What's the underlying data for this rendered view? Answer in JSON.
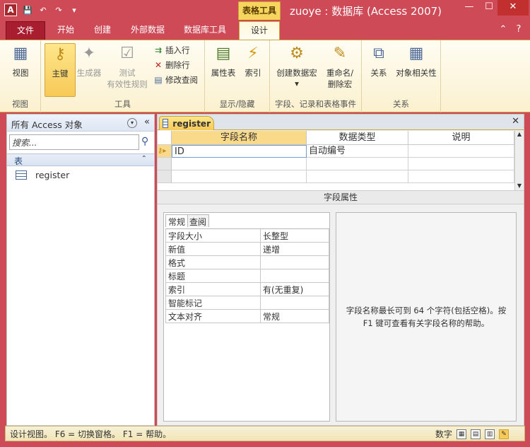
{
  "window": {
    "title": "zuoye : 数据库 (Access 2007)",
    "context_tab": "表格工具"
  },
  "qat": {
    "app_icon": "A"
  },
  "tabs": [
    {
      "label": "文件"
    },
    {
      "label": "开始"
    },
    {
      "label": "创建"
    },
    {
      "label": "外部数据"
    },
    {
      "label": "数据库工具"
    },
    {
      "label": "设计"
    }
  ],
  "ribbon": {
    "view": {
      "title": "视图",
      "btn": "视图"
    },
    "tools": {
      "title": "工具",
      "primary_key": "主键",
      "builder": "生成器",
      "test_line1": "测试",
      "test_line2": "有效性规则",
      "insert_row": "插入行",
      "delete_row": "删除行",
      "modify_lookup": "修改查阅"
    },
    "showhide": {
      "title": "显示/隐藏",
      "property_sheet": "属性表",
      "indexes": "索引"
    },
    "events": {
      "title": "字段、记录和表格事件",
      "create_macro": "创建数据宏",
      "rename_line1": "重命名/",
      "rename_line2": "删除宏"
    },
    "relations": {
      "title": "关系",
      "relationships": "关系",
      "dependencies": "对象相关性"
    }
  },
  "nav": {
    "title": "所有 Access 对象",
    "search_placeholder": "搜索...",
    "section": "表",
    "items": [
      {
        "label": "register"
      }
    ]
  },
  "doc": {
    "tab": "register",
    "headers": {
      "field": "字段名称",
      "type": "数据类型",
      "desc": "说明"
    },
    "rows": [
      {
        "field": "ID",
        "type": "自动编号",
        "desc": ""
      }
    ],
    "props_title": "字段属性",
    "prop_tabs": [
      "常规",
      "查阅"
    ],
    "props": [
      {
        "k": "字段大小",
        "v": "长整型"
      },
      {
        "k": "新值",
        "v": "递增"
      },
      {
        "k": "格式",
        "v": ""
      },
      {
        "k": "标题",
        "v": ""
      },
      {
        "k": "索引",
        "v": "有(无重复)"
      },
      {
        "k": "智能标记",
        "v": ""
      },
      {
        "k": "文本对齐",
        "v": "常规"
      }
    ],
    "help": "字段名称最长可到 64 个字符(包括空格)。按 F1 键可查看有关字段名称的帮助。"
  },
  "status": {
    "left": "设计视图。 F6 = 切换窗格。 F1 = 帮助。",
    "right": "数字"
  },
  "colors": {
    "frame": "#cf4a57",
    "ribbon": "#fbf1cf",
    "highlight": "#f9d98a"
  }
}
